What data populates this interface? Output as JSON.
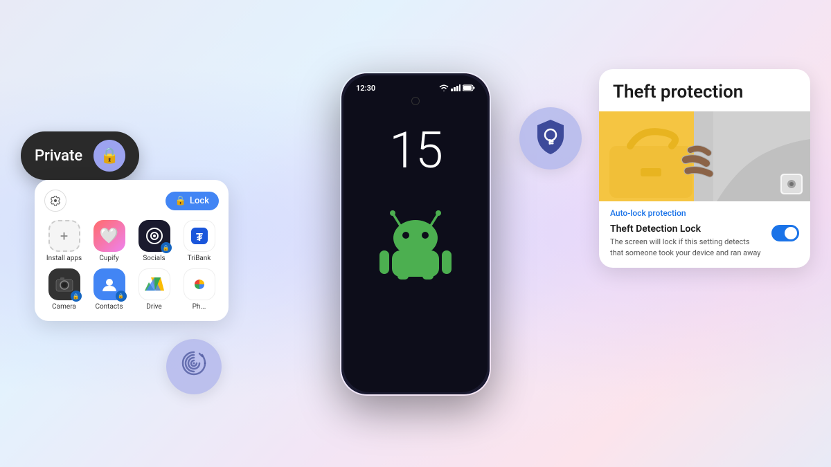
{
  "background": {
    "gradient": "light blue-purple gradient"
  },
  "phone": {
    "time": "12:30",
    "clock_number": "15",
    "status_bar": {
      "time": "12:30",
      "wifi": "wifi-icon",
      "signal": "signal-icon",
      "battery": "battery-icon"
    }
  },
  "private_pill": {
    "label": "Private",
    "icon": "lock-icon"
  },
  "app_grid": {
    "gear_label": "⚙",
    "lock_button": "Lock",
    "apps": [
      {
        "name": "Install apps",
        "icon": "+",
        "type": "add"
      },
      {
        "name": "Cupify",
        "icon": "❤",
        "type": "cupify"
      },
      {
        "name": "Socials",
        "icon": "◎",
        "type": "socials"
      },
      {
        "name": "TriBank",
        "icon": "₮",
        "type": "tribank"
      },
      {
        "name": "Camera",
        "icon": "📷",
        "type": "camera"
      },
      {
        "name": "Contacts",
        "icon": "👤",
        "type": "contacts"
      },
      {
        "name": "Drive",
        "icon": "△",
        "type": "drive"
      },
      {
        "name": "Photos",
        "icon": "✿",
        "type": "photos"
      }
    ]
  },
  "theft_card": {
    "title": "Theft protection",
    "auto_lock_label": "Auto-lock protection",
    "detection_title": "Theft Detection Lock",
    "detection_desc": "The screen will lock if this setting detects that someone took your device and ran away",
    "toggle_state": "on"
  },
  "fingerprint_bubble": {
    "icon": "fingerprint-icon",
    "label": "fingerprint"
  },
  "shield_bubble": {
    "icon": "shield-key-icon",
    "label": "shield"
  }
}
